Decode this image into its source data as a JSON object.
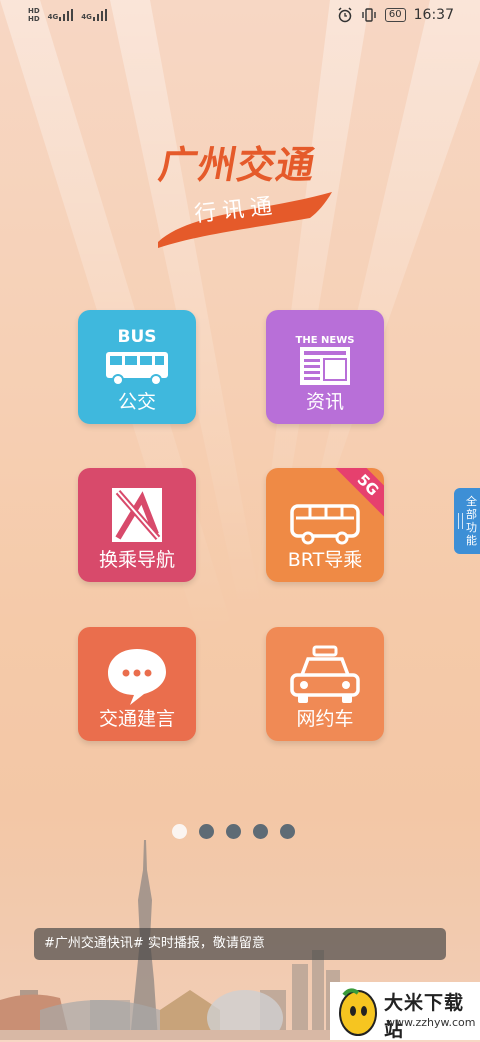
{
  "status_bar": {
    "hd_top": "HD",
    "hd_bottom": "HD",
    "net1": "4G",
    "net2": "4G",
    "battery": "60",
    "time": "16:37",
    "alarm_icon": "alarm-icon",
    "vibrate_icon": "vibrate-icon"
  },
  "logo": {
    "title": "广州交通",
    "subtitle": "行讯通"
  },
  "tiles": [
    {
      "label": "公交",
      "top_text": "BUS",
      "color": "#3fb8dd",
      "icon": "bus-icon"
    },
    {
      "label": "资讯",
      "top_text": "THE NEWS",
      "color": "#b86fd8",
      "icon": "newspaper-icon"
    },
    {
      "label": "换乘导航",
      "color": "#d84a6b",
      "icon": "map-navigation-icon"
    },
    {
      "label": "BRT导乘",
      "badge": "5G",
      "color": "#ef8a45",
      "icon": "brt-bus-icon"
    },
    {
      "label": "交通建言",
      "color": "#ea6e4d",
      "icon": "chat-bubble-icon"
    },
    {
      "label": "网约车",
      "color": "#f08a55",
      "icon": "taxi-icon"
    }
  ],
  "side_tab": {
    "label": "全部功能"
  },
  "pagination": {
    "count": 5,
    "active": 1
  },
  "ticker": {
    "text": "#广州交通快讯# 实时播报，敬请留意"
  },
  "watermark": {
    "text": "大米下载站",
    "url": "www.zzhyw.com"
  }
}
